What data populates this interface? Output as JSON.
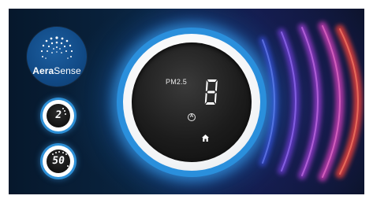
{
  "brand": {
    "name_bold": "Aera",
    "name_regular": "Sense",
    "icon": "dotted-circle-logo-icon"
  },
  "mini_dials": [
    {
      "value": "2",
      "name": "mini-dial-top"
    },
    {
      "value": "50",
      "name": "mini-dial-bottom"
    }
  ],
  "main_display": {
    "label": "PM2.5",
    "digit": "8",
    "mode_icon_symbol": "A",
    "mode_icon": "auto-mode-icon",
    "home_icon": "home-icon"
  },
  "colors": {
    "ring_blue": "#2a8fdc",
    "wave_purple": "#6a3bd0",
    "wave_magenta": "#c03bd8",
    "wave_red": "#e8403c",
    "brand_blue": "#114a86"
  }
}
